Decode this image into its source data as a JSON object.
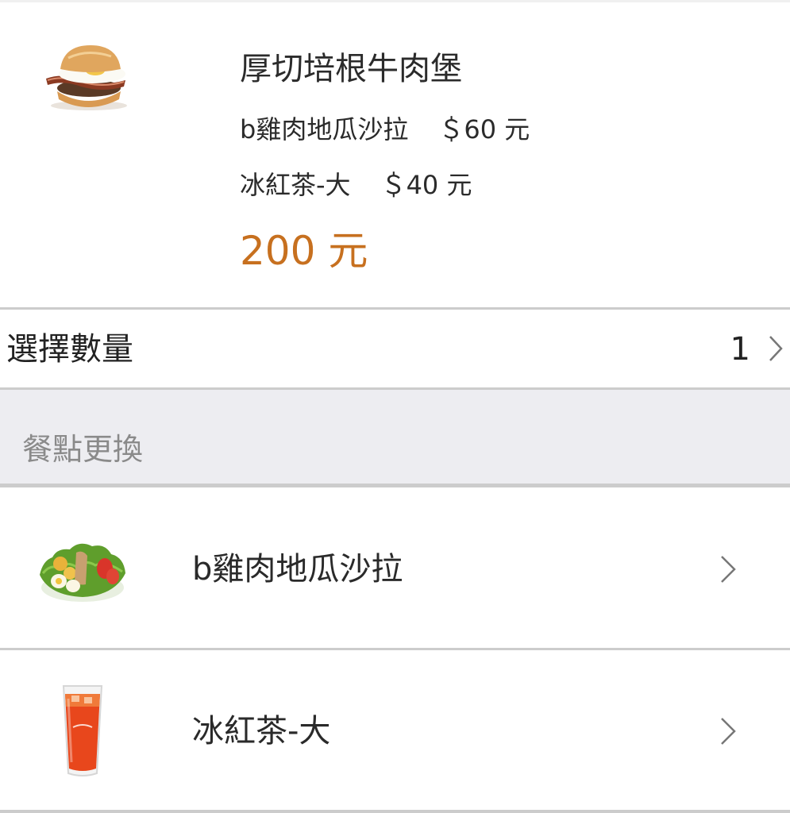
{
  "product": {
    "name": "厚切培根牛肉堡",
    "image_icon": "bacon-beef-burger",
    "combo_items": [
      {
        "name": "b雞肉地瓜沙拉",
        "price": "＄60 元"
      },
      {
        "name": "冰紅茶-大",
        "price": "＄40 元"
      }
    ],
    "total": "200 元",
    "total_color": "#c7701f"
  },
  "quantity": {
    "label": "選擇數量",
    "value": "1"
  },
  "swap_section": {
    "title": "餐點更換",
    "items": [
      {
        "name": "b雞肉地瓜沙拉",
        "image_icon": "chicken-sweet-potato-salad"
      },
      {
        "name": "冰紅茶-大",
        "image_icon": "iced-black-tea"
      }
    ]
  }
}
